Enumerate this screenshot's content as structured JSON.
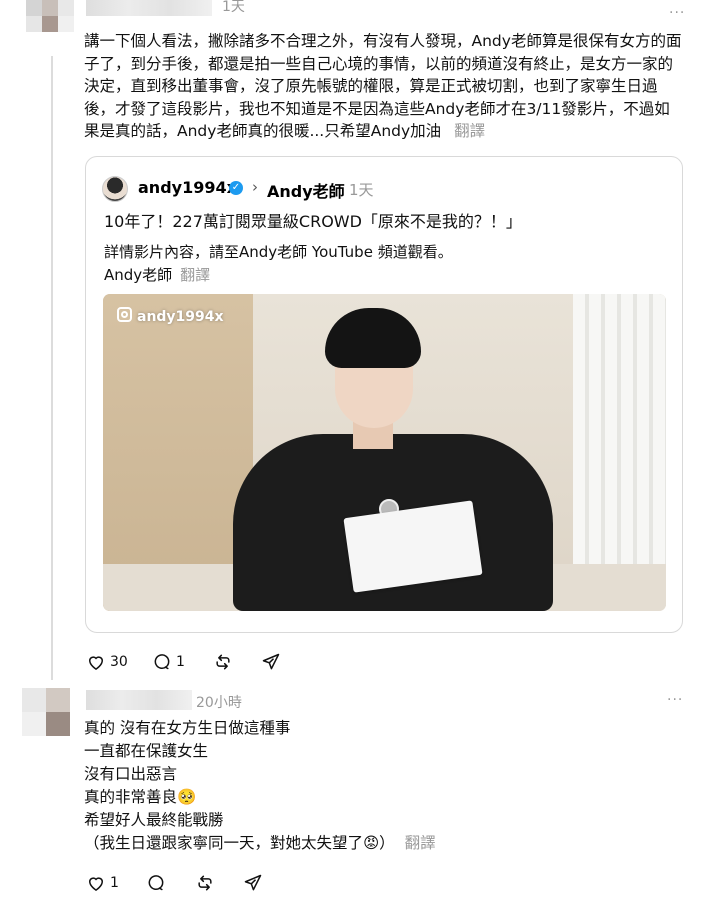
{
  "comment1": {
    "time": "1天",
    "more": "···",
    "text": "講一下個人看法，撇除諸多不合理之外，有沒有人發現，Andy老師算是很保有女方的面子了，到分手後，都還是拍一些自己心境的事情，以前的頻道沒有終止，是女方一家的決定，直到移出董事會，沒了原先帳號的權限，算是正式被切割，也到了家寧生日過後，才發了這段影片，我也不知道是不是因為這些Andy老師才在3/11發影片，不過如果是真的話，Andy老師真的很暖...只希望Andy加油",
    "translate": "翻譯",
    "quote": {
      "username": "andy1994x",
      "verified_mark": "✓",
      "chevron": "›",
      "reply_to": "Andy老師",
      "time": "1天",
      "title": "10年了！227萬訂閱眾量級CROWD「原來不是我的？！」",
      "body_line1": "詳情影片內容，請至Andy老師 YouTube 頻道觀看。",
      "body_line2": "Andy老師",
      "translate": "翻譯",
      "media_badge": "andy1994x"
    },
    "actions": {
      "likes": "30",
      "replies": "1"
    }
  },
  "comment2": {
    "time": "20小時",
    "more": "···",
    "lines": [
      "真的 沒有在女方生日做這種事",
      "一直都在保護女生",
      "沒有口出惡言",
      "真的非常善良🥺",
      "希望好人最終能戰勝",
      "（我生日還跟家寧同一天，對她太失望了😡）"
    ],
    "translate": "翻譯",
    "actions": {
      "likes": "1"
    }
  },
  "icons": [
    "heart-icon",
    "comment-icon",
    "repost-icon",
    "share-icon",
    "instagram-icon",
    "verified-badge-icon",
    "chevron-right-icon",
    "more-icon"
  ]
}
